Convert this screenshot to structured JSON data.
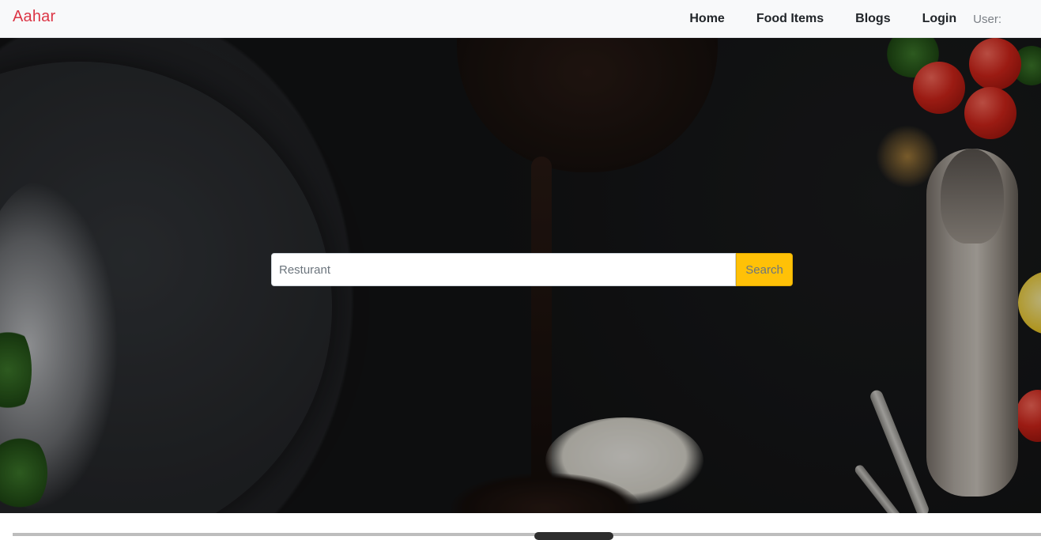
{
  "navbar": {
    "brand": "Aahar",
    "brand_color": "#dc3545",
    "links": [
      {
        "label": "Home"
      },
      {
        "label": "Food Items"
      },
      {
        "label": "Blogs"
      },
      {
        "label": "Login"
      }
    ],
    "user_label": "User:"
  },
  "hero": {
    "search": {
      "value": "",
      "placeholder": "Resturant",
      "button_label": "Search",
      "button_color": "#ffc107"
    }
  }
}
